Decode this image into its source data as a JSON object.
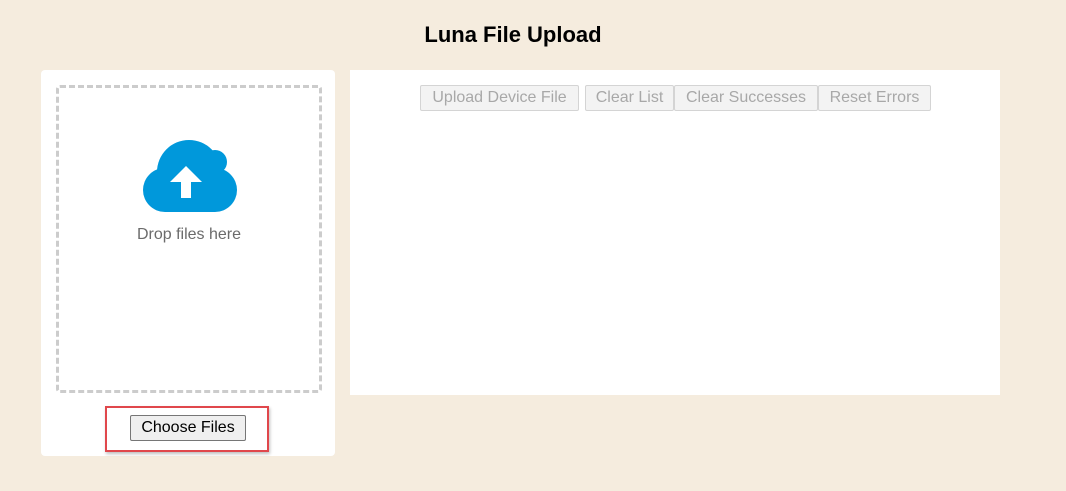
{
  "header": {
    "title": "Luna File Upload"
  },
  "dropzone": {
    "icon": "cloud-upload-icon",
    "text": "Drop files here",
    "icon_color": "#0098db"
  },
  "file_input": {
    "label": "Choose Files"
  },
  "toolbar": {
    "upload_device_file": "Upload Device File",
    "clear_list": "Clear List",
    "clear_successes": "Clear Successes",
    "reset_errors": "Reset Errors",
    "disabled": true
  },
  "colors": {
    "page_background": "#f5ecde",
    "panel_background": "#ffffff",
    "highlight_border": "#e0474c"
  }
}
